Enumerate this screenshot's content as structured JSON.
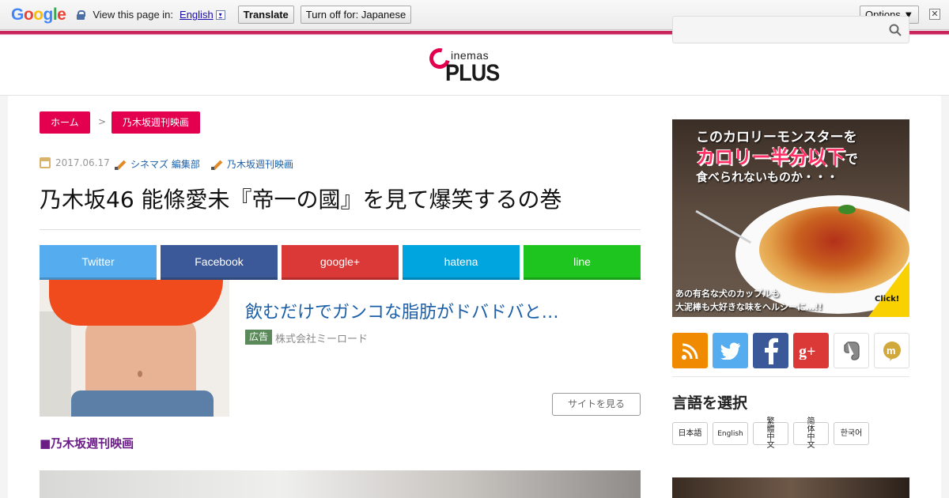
{
  "translate_bar": {
    "logo": "Google",
    "prompt": "View this page in:",
    "language": "English",
    "dropdown_glyph": "▾",
    "translate_button": "Translate",
    "turn_off_button": "Turn off for: Japanese",
    "options_button": "Options ▼",
    "close_glyph": "✕"
  },
  "header": {
    "logo_word": "inemas",
    "logo_plus": "PLUS",
    "search": {
      "value": "",
      "placeholder": ""
    }
  },
  "breadcrumb": {
    "home": "ホーム",
    "separator": ">",
    "category": "乃木坂週刊映画"
  },
  "article": {
    "date": "2017.06.17",
    "author": "シネマズ 編集部",
    "tag": "乃木坂週刊映画",
    "title": "乃木坂46 能條愛未『帝一の國』を見て爆笑するの巻"
  },
  "share": {
    "twitter": "Twitter",
    "facebook": "Facebook",
    "googleplus": "google+",
    "hatena": "hatena",
    "line": "line"
  },
  "ad": {
    "title": "飲むだけでガンコな脂肪がドバドバと…",
    "badge": "広告",
    "sponsor": "株式会社ミーロード",
    "cta": "サイトを見る"
  },
  "section": {
    "heading": "■乃木坂週刊映画"
  },
  "sidebar": {
    "banner": {
      "line1": "このカロリーモンスターを",
      "line2": "カロリー半分以下",
      "line2_suffix": "で",
      "line3": "食べられないものか・・・",
      "line4": "あの有名な犬のカップルも",
      "line5": "大泥棒も大好きな味をヘルシーに…!!",
      "click": "Click!"
    },
    "sns_icons": [
      "rss-icon",
      "twitter-icon",
      "facebook-icon",
      "googleplus-icon",
      "evernote-icon",
      "mixi-icon"
    ],
    "language_heading": "言語を選択",
    "languages": [
      "日本語",
      "English",
      "繁體中文",
      "简体中文",
      "한국어"
    ]
  },
  "colors": {
    "accent": "#e2004f",
    "twitter": "#55acee",
    "facebook": "#3b5998",
    "googleplus": "#db3838",
    "hatena": "#00a4de",
    "line": "#1fc51f",
    "rss": "#f08a00",
    "link": "#1b5fa8",
    "section_heading": "#6b1d86"
  }
}
